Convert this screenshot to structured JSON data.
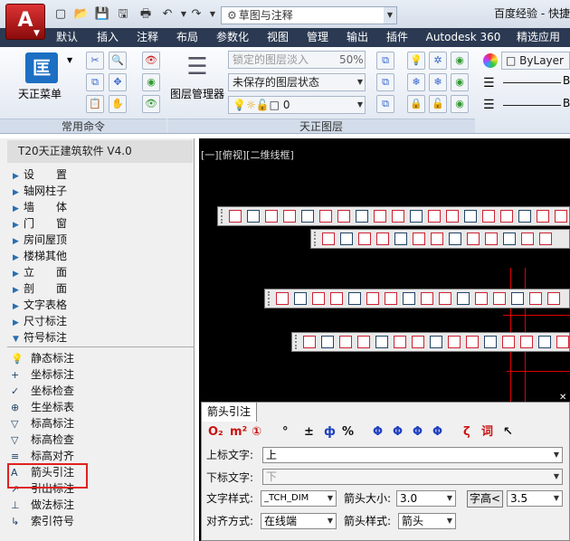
{
  "title_bar": {
    "app_button": "A",
    "workspace": "草图与注释",
    "app_title": "百度经验 - 快捷"
  },
  "ribbon_tabs": [
    "默认",
    "插入",
    "注释",
    "布局",
    "参数化",
    "视图",
    "管理",
    "输出",
    "插件",
    "Autodesk 360",
    "精选应用"
  ],
  "ribbon": {
    "tz_menu_label": "天正菜单",
    "common_group_title": "常用命令",
    "layer_manager_label": "图层管理器",
    "locked_layer_label": "锁定的图层",
    "fade_label": "淡入",
    "fade_value": "50%",
    "layer_state": "未保存的图层状态",
    "current_layer": "0",
    "tz_layer_group_title": "天正图层",
    "bylayer_label": "ByLayer",
    "linetype_suffix": "B",
    "lineweight_suffix": "B"
  },
  "palette": {
    "header": "T20天正建筑软件 V4.0",
    "categories": [
      "设　　置",
      "轴网柱子",
      "墙　　体",
      "门　　窗",
      "房间屋顶",
      "楼梯其他",
      "立　　面",
      "剖　　面",
      "文字表格",
      "尺寸标注",
      "符号标注"
    ],
    "expanded_index": 10,
    "sub_items": [
      "静态标注",
      "坐标标注",
      "坐标检查",
      "生坐标表",
      "标高标注",
      "标高检查",
      "标高对齐",
      "箭头引注",
      "引出标注",
      "做法标注",
      "索引符号"
    ],
    "sub_icons": [
      "💡",
      "+",
      "✓",
      "⊕",
      "▽",
      "▽",
      "≡",
      "A",
      "↗",
      "⊥",
      "↳"
    ],
    "highlighted_item": "箭头引注"
  },
  "viewport": {
    "label": "[一][俯视][二维线框]"
  },
  "arrow_note_panel": {
    "tab_title": "箭头引注",
    "symbols": [
      "O₂",
      "m²",
      "①",
      "°",
      "±",
      "ф",
      "%",
      "Φ",
      "Φ",
      "Φ",
      "Φ",
      "ζ",
      "词",
      "↖"
    ],
    "upper_text_label": "上标文字:",
    "upper_text_value": "上",
    "lower_text_label": "下标文字:",
    "lower_text_value": "下",
    "text_style_label": "文字样式:",
    "text_style_value": "_TCH_DIM",
    "arrow_size_label": "箭头大小:",
    "arrow_size_value": "3.0",
    "char_height_label": "字高<",
    "char_height_value": "3.5",
    "align_label": "对齐方式:",
    "align_value": "在线端",
    "arrow_style_label": "箭头样式:",
    "arrow_style_value": "箭头"
  },
  "colors": {
    "tab_bar": "#2b3a52",
    "viewport_bg": "#000000",
    "highlight": "#e02020",
    "symbol_red": "#cc1111",
    "symbol_blue": "#1f3fbf"
  }
}
